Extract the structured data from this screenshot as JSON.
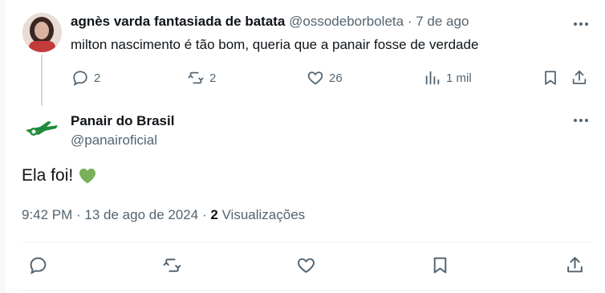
{
  "reply": {
    "display_name": "agnès varda fantasiada de batata",
    "handle": "@ossodeborboleta",
    "separator": "·",
    "time": "7 de ago",
    "text": "milton nascimento é tão bom, queria que a panair fosse de verdade",
    "actions": {
      "replies": "2",
      "reposts": "2",
      "likes": "26",
      "views": "1 mil"
    }
  },
  "main": {
    "display_name": "Panair do Brasil",
    "handle": "@panairoficial",
    "text": "Ela foi!",
    "emoji": "green-heart",
    "timestamp": "9:42 PM · 13 de ago de 2024 · ",
    "views_count": "2",
    "views_label": " Visualizações"
  },
  "colors": {
    "text": "#0f1419",
    "muted": "#536471",
    "panair_green": "#1f8a3b",
    "heart_green": "#78b159"
  }
}
